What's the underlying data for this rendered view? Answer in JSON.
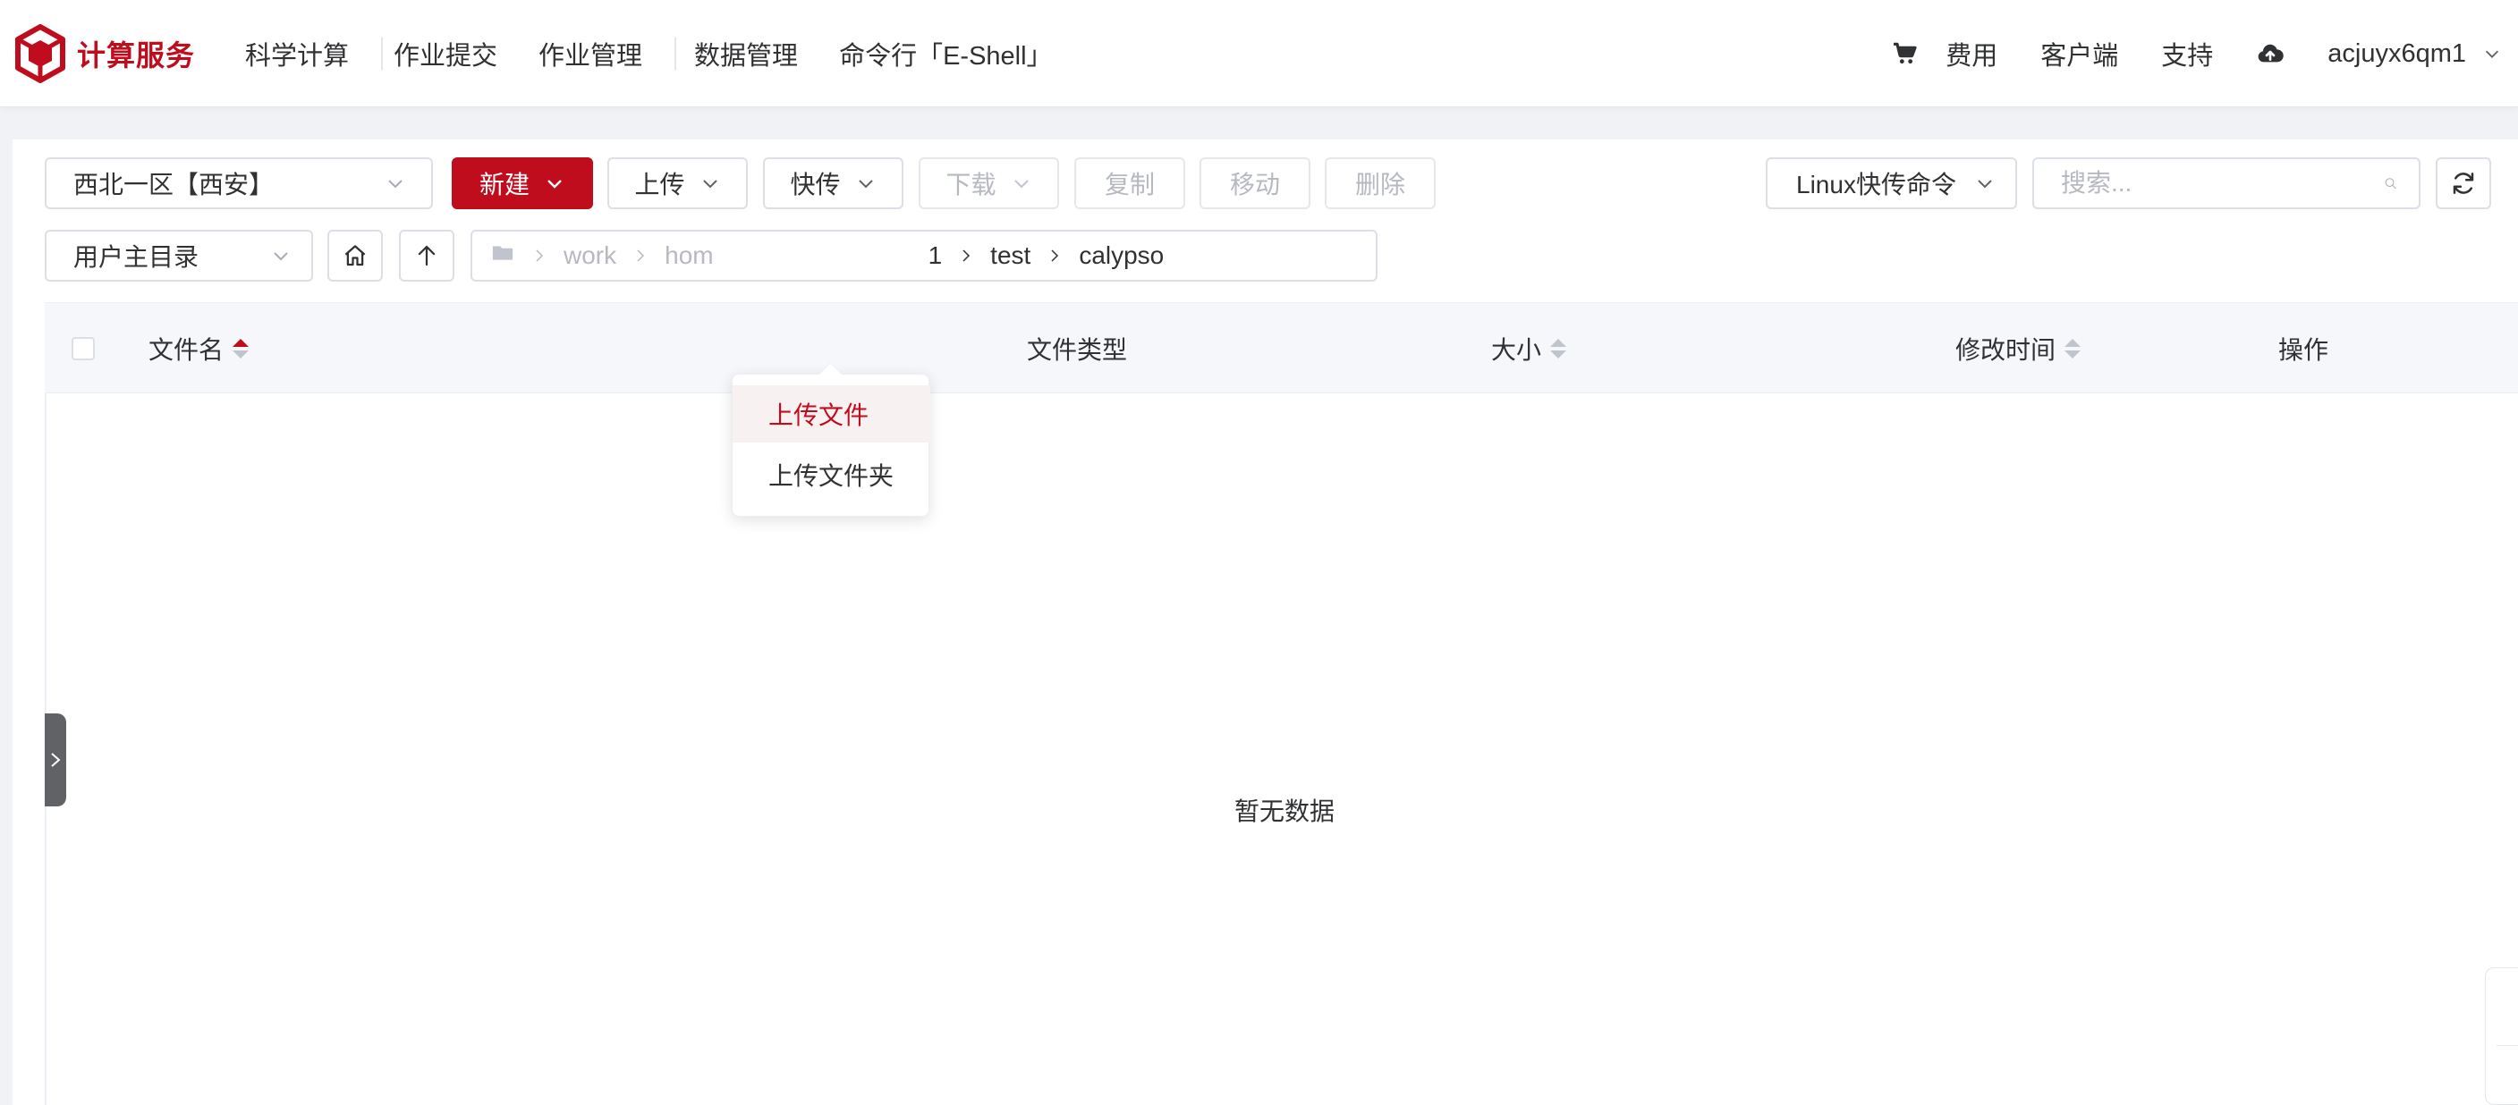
{
  "app": {
    "logo_text": "计算服务",
    "brand_color": "#c00d1e"
  },
  "nav": {
    "items": [
      "科学计算",
      "作业提交",
      "作业管理",
      "数据管理",
      "命令行「E-Shell」"
    ]
  },
  "right_nav": {
    "cart_icon": "cart-icon",
    "fees": "费用",
    "client": "客户端",
    "support": "支持",
    "cloud_icon": "cloud-upload-icon",
    "username": "acjuyx6qm1"
  },
  "toolbar": {
    "region": "西北一区【西安】",
    "new_label": "新建",
    "upload_label": "上传",
    "quick_label": "快传",
    "download_label": "下载",
    "copy_label": "复制",
    "move_label": "移动",
    "delete_label": "删除",
    "linux_cmd_label": "Linux快传命令",
    "search_placeholder": "搜索..."
  },
  "pathbar": {
    "root_select": "用户主目录",
    "segments": [
      "work",
      "hom",
      "1",
      "test",
      "calypso"
    ]
  },
  "table": {
    "columns": {
      "name": "文件名",
      "type": "文件类型",
      "size": "大小",
      "modified": "修改时间",
      "actions": "操作"
    },
    "empty_text": "暂无数据"
  },
  "upload_menu": {
    "items": [
      "上传文件",
      "上传文件夹"
    ],
    "active_index": 0
  }
}
